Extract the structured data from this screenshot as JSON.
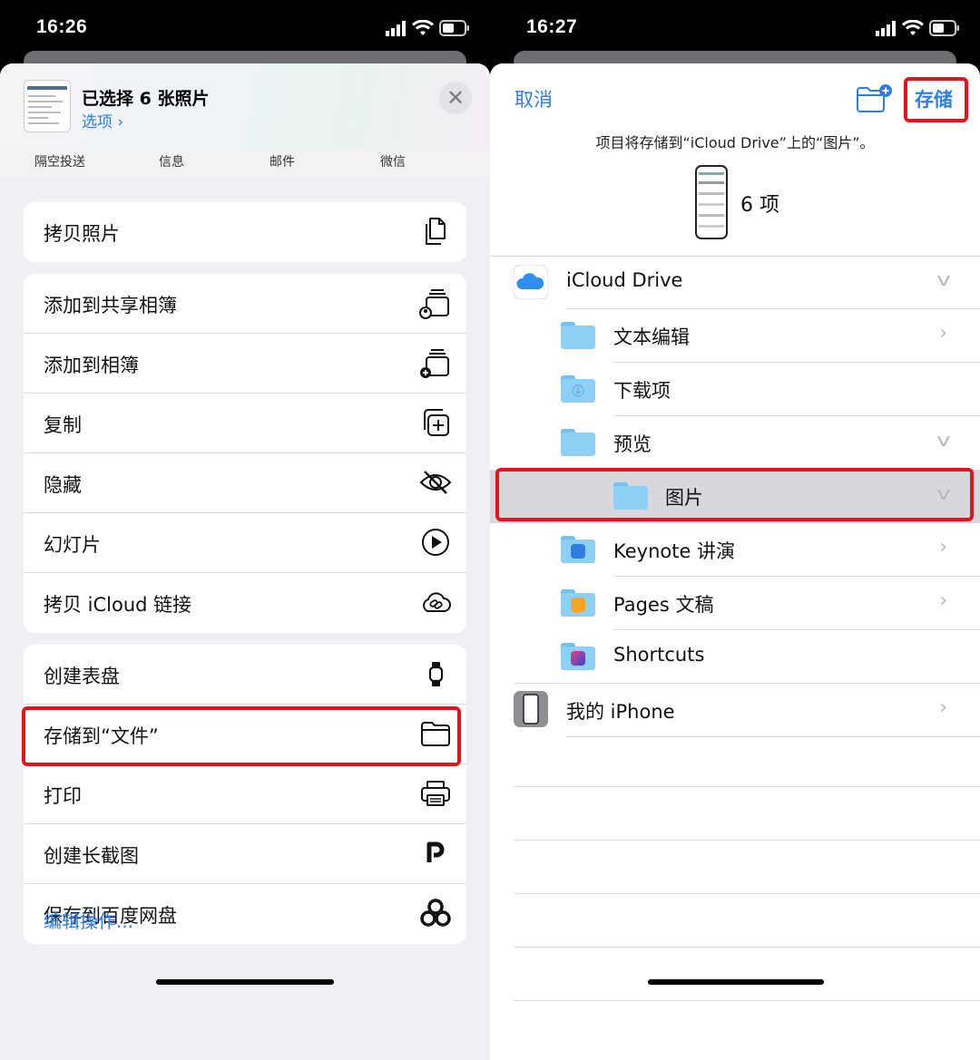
{
  "left": {
    "status": {
      "time": "16:26"
    },
    "header": {
      "title": "已选择 6 张照片",
      "options": "选项 ›",
      "close": "✕"
    },
    "apps": [
      "隔空投送",
      "信息",
      "邮件",
      "微信"
    ],
    "groups": [
      [
        {
          "label": "拷贝照片",
          "icon": "copy-icon"
        }
      ],
      [
        {
          "label": "添加到共享相簿",
          "icon": "shared-album-icon"
        },
        {
          "label": "添加到相簿",
          "icon": "add-album-icon"
        },
        {
          "label": "复制",
          "icon": "duplicate-icon"
        },
        {
          "label": "隐藏",
          "icon": "hide-eye-icon"
        },
        {
          "label": "幻灯片",
          "icon": "play-icon"
        },
        {
          "label": "拷贝 iCloud 链接",
          "icon": "cloud-link-icon"
        }
      ],
      [
        {
          "label": "创建表盘",
          "icon": "watch-icon"
        },
        {
          "label": "存储到“文件”",
          "icon": "folder-icon"
        },
        {
          "label": "打印",
          "icon": "printer-icon"
        },
        {
          "label": "创建长截图",
          "icon": "p-icon"
        },
        {
          "label": "保存到百度网盘",
          "icon": "baidu-icon"
        }
      ]
    ],
    "edit_actions": "编辑操作..."
  },
  "right": {
    "status": {
      "time": "16:27"
    },
    "nav": {
      "cancel": "取消",
      "save": "存储"
    },
    "destination": "项目将存储到“iCloud Drive”上的“图片”。",
    "count": "6 项",
    "locations": [
      {
        "name": "iCloud Drive",
        "level": 0,
        "kind": "icloud",
        "chevron": "down"
      },
      {
        "name": "文本编辑",
        "level": 1,
        "kind": "folder",
        "chevron": "right"
      },
      {
        "name": "下载项",
        "level": 1,
        "kind": "download",
        "chevron": "none"
      },
      {
        "name": "预览",
        "level": 1,
        "kind": "folder",
        "chevron": "down"
      },
      {
        "name": "图片",
        "level": 2,
        "kind": "folder",
        "chevron": "down",
        "selected": true
      },
      {
        "name": "Keynote 讲演",
        "level": 1,
        "kind": "keynote",
        "chevron": "right"
      },
      {
        "name": "Pages 文稿",
        "level": 1,
        "kind": "pages",
        "chevron": "right"
      },
      {
        "name": "Shortcuts",
        "level": 1,
        "kind": "shortcuts",
        "chevron": "none"
      },
      {
        "name": "我的 iPhone",
        "level": 0,
        "kind": "iphone",
        "chevron": "right"
      }
    ]
  },
  "colors": {
    "accent": "#2f7ee0",
    "highlight": "#e4141c",
    "folder": "#8dd0f5"
  }
}
